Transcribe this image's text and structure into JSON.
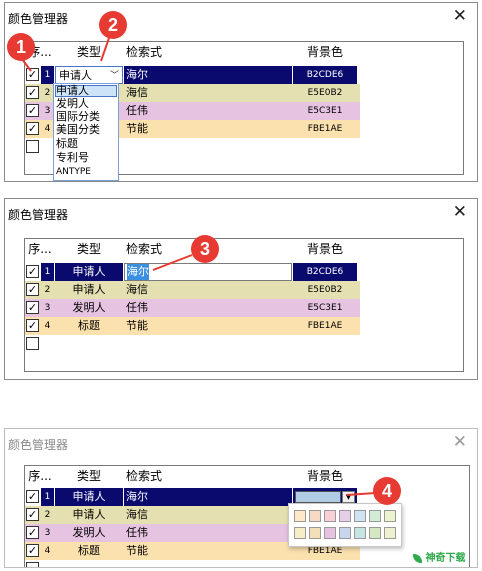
{
  "dialog_title": "颜色管理器",
  "close_glyph": "✕",
  "headers": {
    "seq": "序...",
    "type": "类型",
    "search": "检索式",
    "bg": "背景色"
  },
  "row_colors": {
    "sel": "#0a0a6e",
    "r2": "#e5e0b2",
    "r3": "#e5c3e1",
    "r4": "#fbe1ae",
    "r1": "#b2cde6"
  },
  "rows": [
    {
      "num": "1",
      "type": "申请人",
      "search": "海尔",
      "bg": "B2CDE6"
    },
    {
      "num": "2",
      "type": "申请人",
      "search": "海信",
      "bg": "E5E0B2"
    },
    {
      "num": "3",
      "type": "发明人",
      "search": "任伟",
      "bg": "E5C3E1"
    },
    {
      "num": "4",
      "type": "标题",
      "search": "节能",
      "bg": "FBE1AE"
    }
  ],
  "panel1": {
    "combo_value": "申请人",
    "dropdown_items": [
      "申请人",
      "发明人",
      "国际分类",
      "美国分类",
      "标题",
      "专利号",
      "ANTYPE"
    ],
    "badge1": "1",
    "badge2": "2",
    "row2_type": "申请人",
    "row3_type": "发明人",
    "row4_type": "标题"
  },
  "panel2": {
    "edit_value": "海尔",
    "badge3": "3"
  },
  "panel3": {
    "badge4": "4",
    "partial_bg": "FBE1AE"
  },
  "checkmark": "✓",
  "watermark": "神奇下载",
  "palette_colors": [
    "#fde9c8",
    "#f7d9c4",
    "#f8cfd6",
    "#e6cde8",
    "#cfe3f2",
    "#d3ecd6",
    "#eaf3cc",
    "#f6eec7",
    "#f3e0b8",
    "#e5c3e1",
    "#c7d6ee",
    "#c5e6e3",
    "#d5e8c2",
    "#eef0cf"
  ]
}
